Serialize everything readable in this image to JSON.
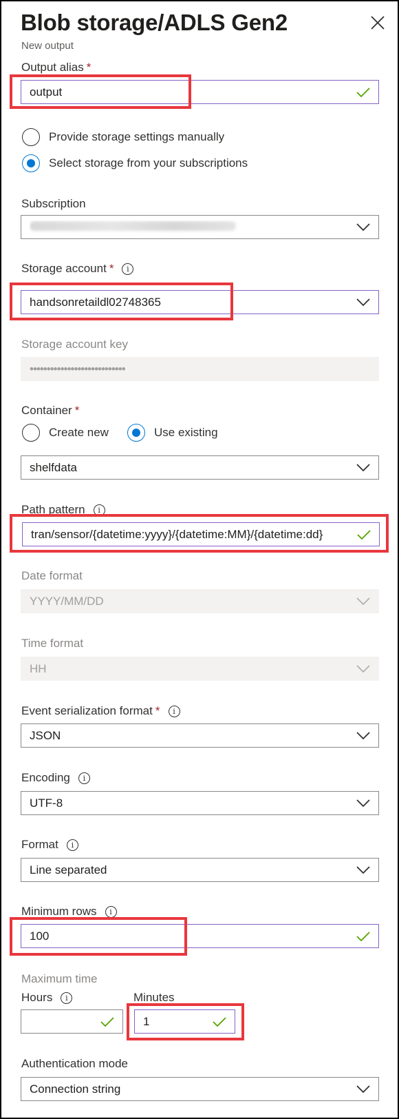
{
  "panel": {
    "title": "Blob storage/ADLS Gen2",
    "subtitle": "New output"
  },
  "required_mark": "*",
  "info_glyph": "i",
  "output_alias": {
    "label": "Output alias",
    "value": "output"
  },
  "storage_mode": {
    "options": [
      "Provide storage settings manually",
      "Select storage from your subscriptions"
    ],
    "selected": "Select storage from your subscriptions"
  },
  "subscription": {
    "label": "Subscription",
    "value": "Synapse Analytics Demos and Labs"
  },
  "storage_account": {
    "label": "Storage account",
    "value": "handsonretaildl02748365"
  },
  "storage_account_key": {
    "label": "Storage account key",
    "value": "••••••••••••••••••••••••••••"
  },
  "container": {
    "label": "Container",
    "options": [
      "Create new",
      "Use existing"
    ],
    "selected": "Use existing",
    "value": "shelfdata"
  },
  "path_pattern": {
    "label": "Path pattern",
    "value": "tran/sensor/{datetime:yyyy}/{datetime:MM}/{datetime:dd}"
  },
  "date_format": {
    "label": "Date format",
    "value": "YYYY/MM/DD"
  },
  "time_format": {
    "label": "Time format",
    "value": "HH"
  },
  "event_serialization_format": {
    "label": "Event serialization format",
    "value": "JSON"
  },
  "encoding": {
    "label": "Encoding",
    "value": "UTF-8"
  },
  "format": {
    "label": "Format",
    "value": "Line separated"
  },
  "minimum_rows": {
    "label": "Minimum rows",
    "value": "100"
  },
  "maximum_time": {
    "label": "Maximum time",
    "hours_label": "Hours",
    "hours_value": "",
    "minutes_label": "Minutes",
    "minutes_value": "1"
  },
  "authentication_mode": {
    "label": "Authentication mode",
    "value": "Connection string"
  },
  "colors": {
    "highlight": "#e8373d",
    "accent": "#0078d4",
    "focus_border": "#8661c5",
    "valid_check": "#57a300",
    "required": "#a4262c"
  }
}
